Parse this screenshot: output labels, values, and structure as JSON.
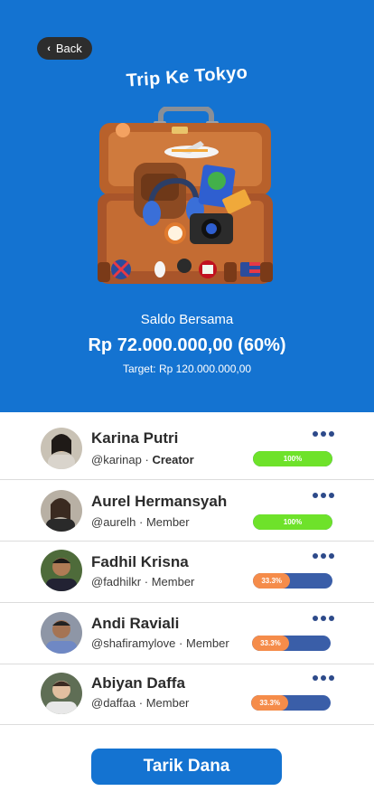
{
  "header": {
    "back_label": "Back",
    "title": "Trip Ke Tokyo"
  },
  "saldo": {
    "label": "Saldo Bersama",
    "value": "Rp 72.000.000,00 (60%)",
    "target": "Target: Rp 120.000.000,00"
  },
  "members": [
    {
      "name": "Karina Putri",
      "handle": "@karinap",
      "role": "Creator",
      "progress_label": "100%",
      "progress": 1.0
    },
    {
      "name": "Aurel Hermansyah",
      "handle": "@aurelh",
      "role": "Member",
      "progress_label": "100%",
      "progress": 1.0
    },
    {
      "name": "Fadhil Krisna",
      "handle": "@fadhilkr",
      "role": "Member",
      "progress_label": "33.3%",
      "progress": 0.333
    },
    {
      "name": "Andi Raviali",
      "handle": "@shafiramylove",
      "role": "Member",
      "progress_label": "33.3%",
      "progress": 0.333
    },
    {
      "name": "Abiyan Daffa",
      "handle": "@daffaa",
      "role": "Member",
      "progress_label": "33.3%",
      "progress": 0.333
    }
  ],
  "separator": "·",
  "action": {
    "withdraw_label": "Tarik Dana"
  },
  "colors": {
    "primary": "#1473d1",
    "complete": "#6ee22a",
    "partial": "#f58c4a",
    "track": "#3a5ea8"
  }
}
